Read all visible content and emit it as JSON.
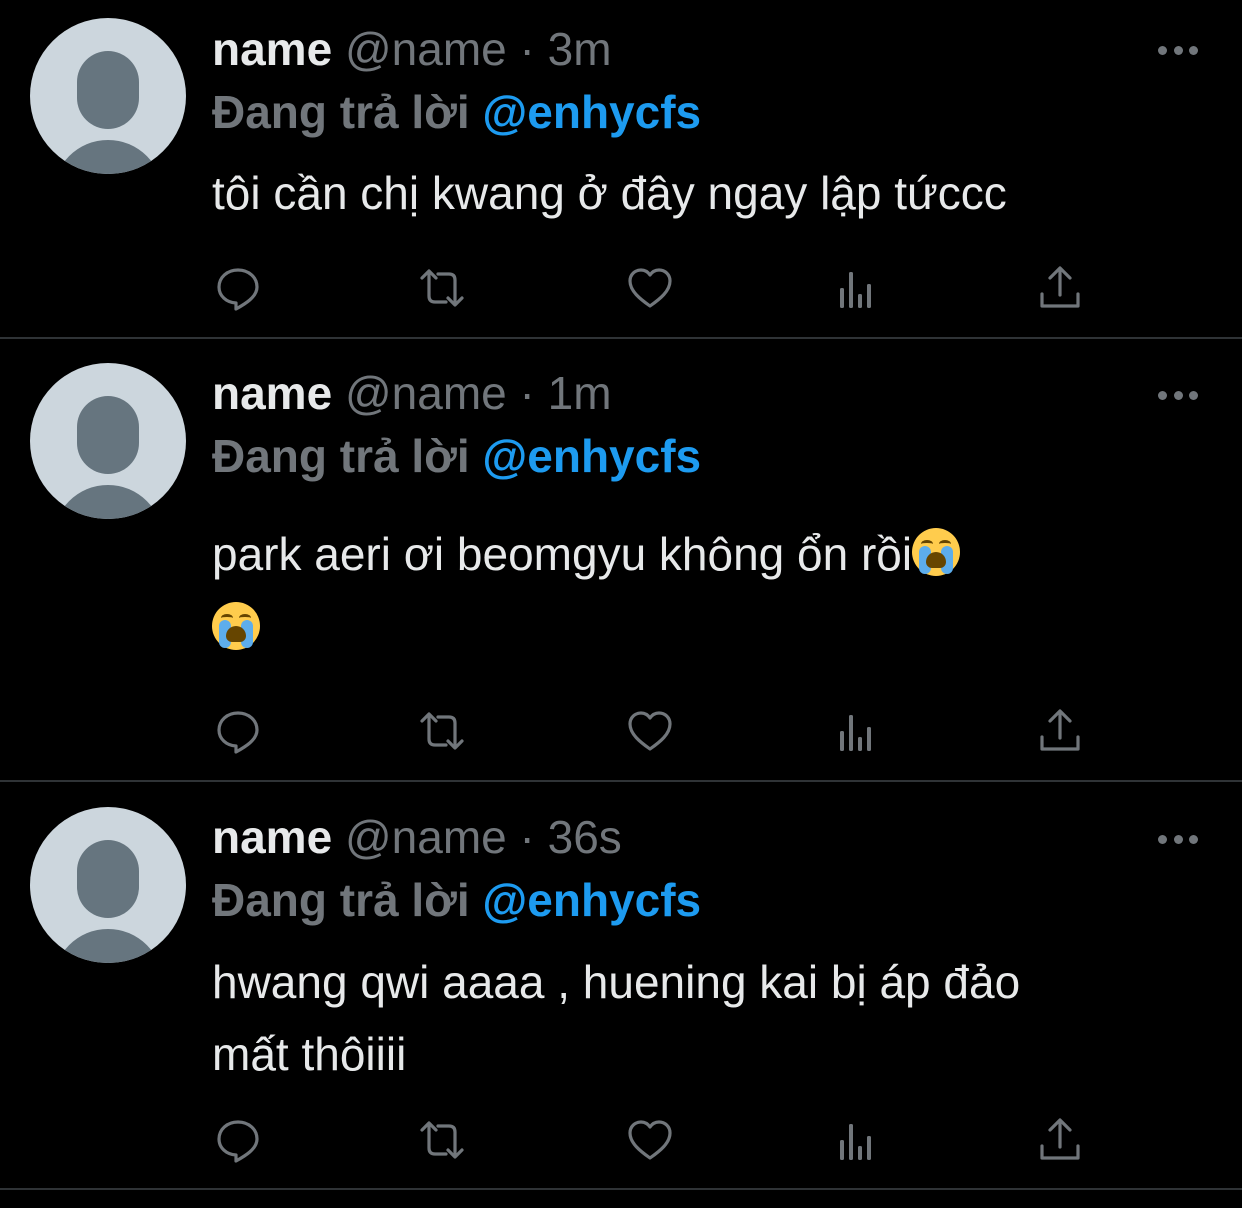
{
  "tweets": [
    {
      "display_name": "name",
      "handle": "@name",
      "separator": "·",
      "time": "3m",
      "reply_prefix": "Đang trả lời",
      "reply_target": "@enhycfs",
      "text_line_1": "tôi cần chị kwang ở đây ngay lập tứccc"
    },
    {
      "display_name": "name",
      "handle": "@name",
      "separator": "·",
      "time": "1m",
      "reply_prefix": "Đang trả lời",
      "reply_target": "@enhycfs",
      "text_line_1": "park aeri ơi beomgyu không ổn rồi",
      "emoji": "loudly-crying-face"
    },
    {
      "display_name": "name",
      "handle": "@name",
      "separator": "·",
      "time": "36s",
      "reply_prefix": "Đang trả lời",
      "reply_target": "@enhycfs",
      "text_line_1": "hwang qwi aaaa , huening kai bị áp đảo",
      "text_line_2": "mất thôiiii"
    }
  ],
  "action_icons": [
    "reply-icon",
    "retweet-icon",
    "like-icon",
    "analytics-icon",
    "share-icon"
  ],
  "colors": {
    "background": "#000000",
    "primary_text": "#e7e9ea",
    "secondary_text": "#71767b",
    "accent": "#1d9bf0",
    "divider": "#2f3336"
  }
}
